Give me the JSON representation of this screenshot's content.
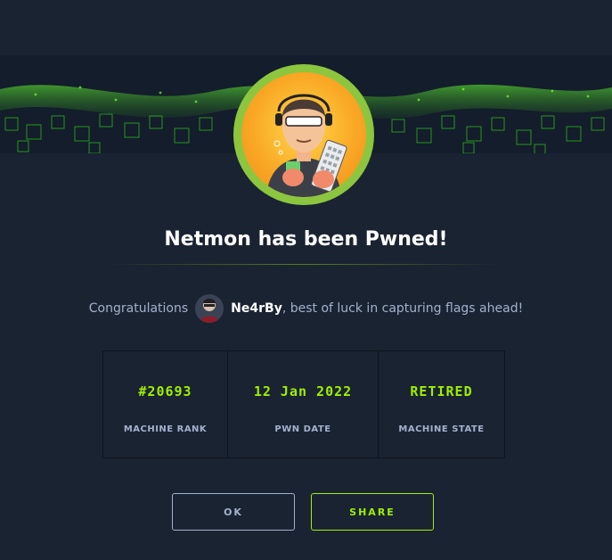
{
  "modal": {
    "title": "Netmon has been Pwned!",
    "congrats_prefix": "Congratulations",
    "username": "Ne4rBy",
    "congrats_suffix": ", best of luck in capturing flags ahead!"
  },
  "stats": [
    {
      "value": "#20693",
      "label": "MACHINE RANK"
    },
    {
      "value": "12 Jan 2022",
      "label": "PWN DATE"
    },
    {
      "value": "RETIRED",
      "label": "MACHINE STATE"
    }
  ],
  "buttons": {
    "ok_label": "OK",
    "share_label": "SHARE"
  },
  "colors": {
    "background": "#1a2332",
    "accent": "#9fef00",
    "muted_text": "#a4b1cd",
    "avatar_ring": "#8cc63f"
  },
  "icons": {
    "banner": "green-cube-grid-banner",
    "machine_avatar": "hacker-with-keyboard-avatar",
    "user_avatar": "user-avatar"
  }
}
